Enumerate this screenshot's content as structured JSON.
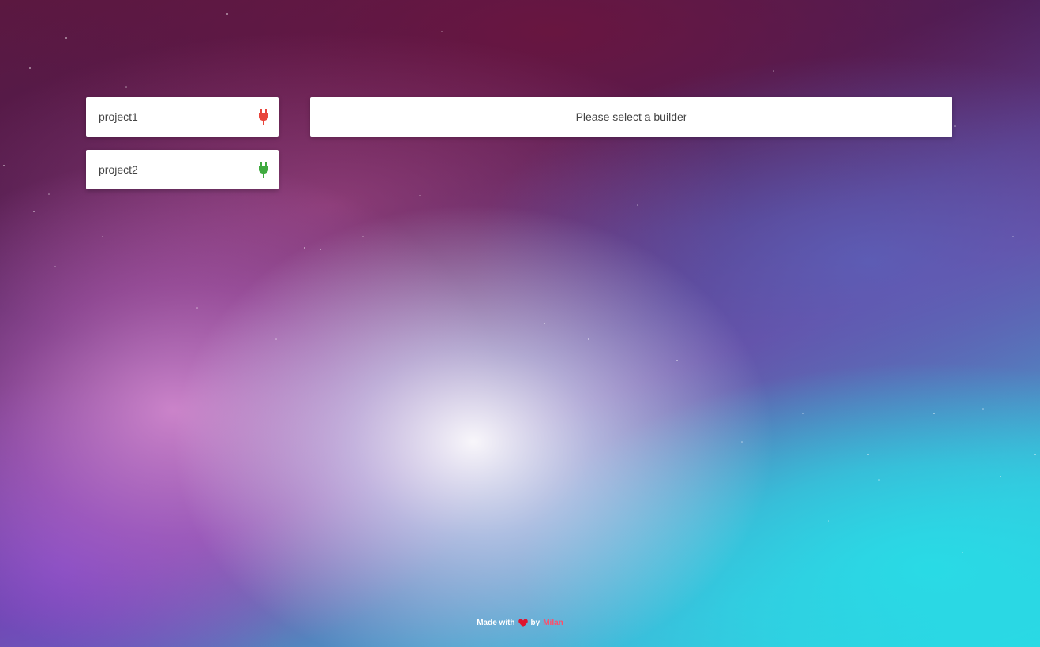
{
  "projects": [
    {
      "name": "project1",
      "status": "disconnected",
      "icon": "plug-icon",
      "status_color": "#e8443a"
    },
    {
      "name": "project2",
      "status": "connected",
      "icon": "plug-icon",
      "status_color": "#3faa3f"
    }
  ],
  "builder_panel": {
    "message": "Please select a builder"
  },
  "footer": {
    "prefix": "Made with",
    "icon": "heart-icon",
    "by": "by",
    "author": "Milan",
    "author_color": "#ff4d6a"
  }
}
